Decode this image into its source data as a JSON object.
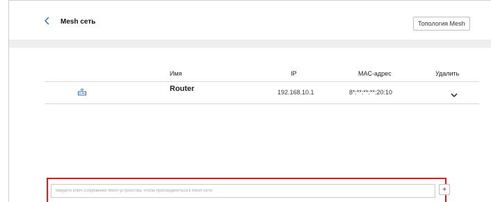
{
  "header": {
    "title": "Mesh сеть",
    "topology_button": "Топология Mesh"
  },
  "table": {
    "columns": {
      "name": "Имя",
      "ip": "IP",
      "mac": "MAC-адрес",
      "delete": "Удалить"
    },
    "rows": [
      {
        "icon": "router-icon",
        "name": "Router",
        "ip": "192.168.10.1",
        "mac": "8*:**:**:**:20:10"
      }
    ]
  },
  "pairing": {
    "placeholder": "Введите ключ сопряжения Mesh-устройства, чтобы присоединиться к Mesh-сети.",
    "add_label": "+"
  },
  "colors": {
    "accent": "#2b6cb0",
    "highlight": "#e01818",
    "band": "#eeeeee"
  }
}
